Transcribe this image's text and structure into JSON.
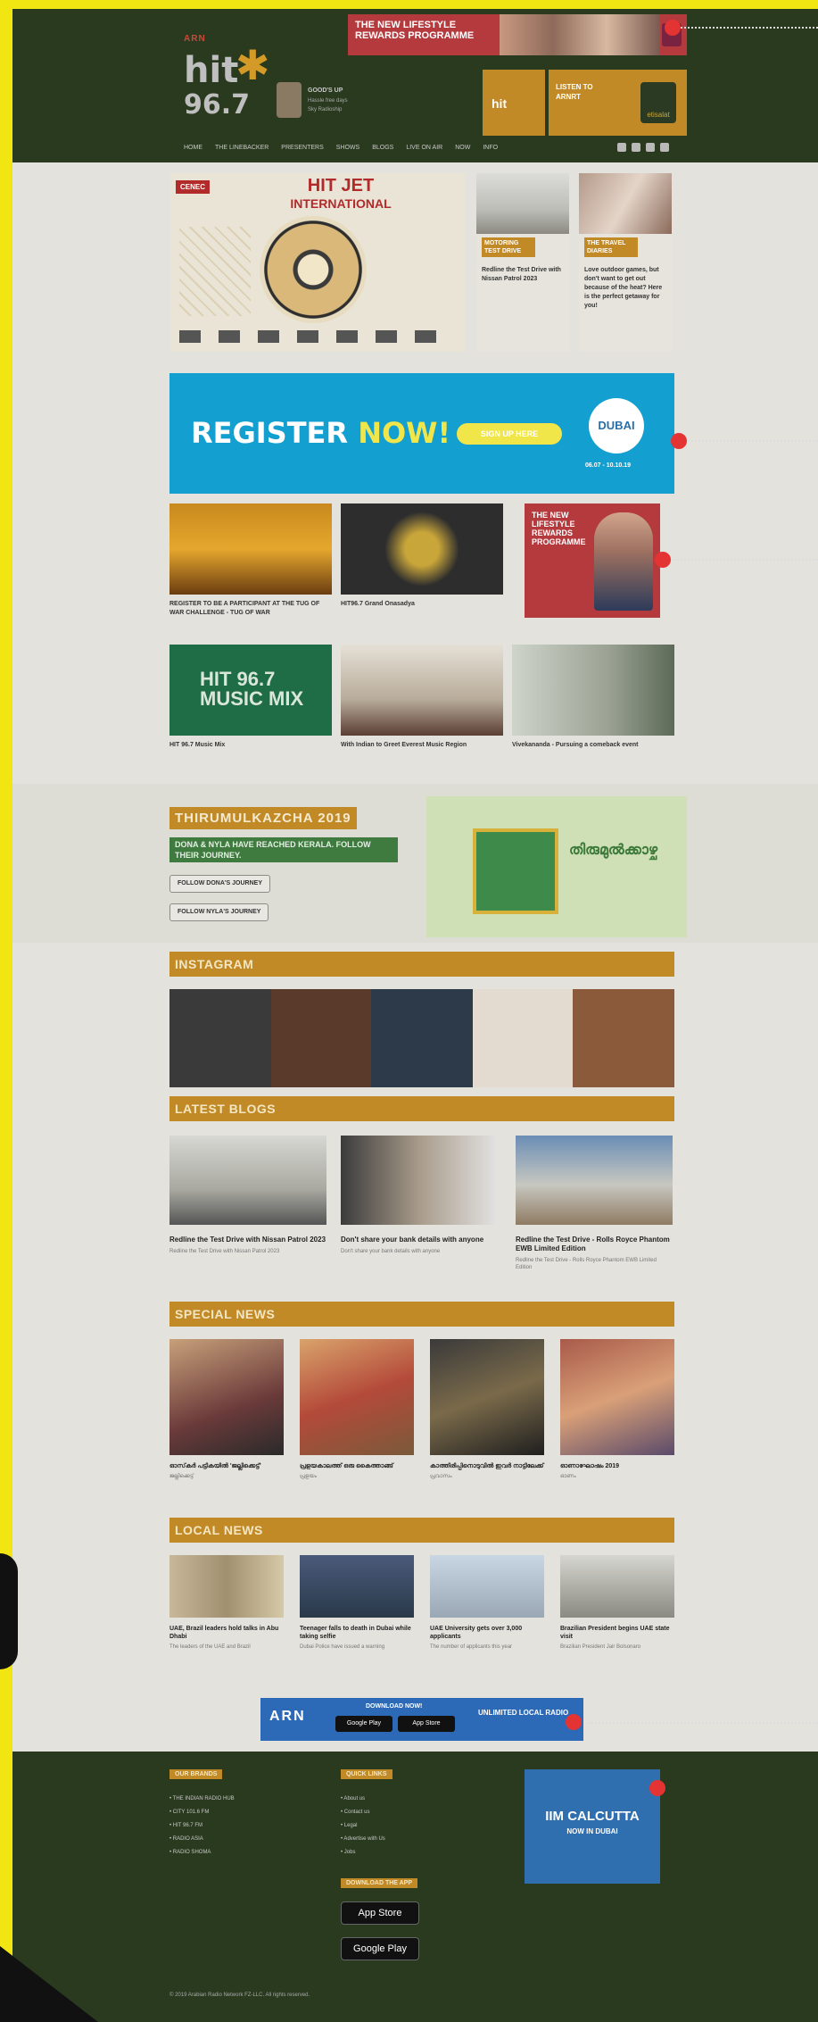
{
  "header": {
    "logo": {
      "brand": "ARN",
      "hit": "hit",
      "number": "96.7"
    },
    "show": {
      "line1": "GOOD'S UP",
      "line2": "Hassle free days",
      "line3": "Sky Radioship"
    },
    "top_banner": {
      "text": "THE NEW LIFESTYLE REWARDS PROGRAMME"
    },
    "promo_tile": {
      "label": "hit"
    },
    "listen_tile": {
      "text": "LISTEN TO ARNRT",
      "brand": "etisalat"
    },
    "nav": [
      "HOME",
      "THE LINEBACKER",
      "PRESENTERS",
      "SHOWS",
      "BLOGS",
      "LIVE ON AIR",
      "NOW",
      "INFO"
    ]
  },
  "hero": {
    "tag": "CENEC",
    "title": "HIT JET",
    "subtitle": "INTERNATIONAL"
  },
  "side_cards": [
    {
      "label": "MOTORING TEST DRIVE",
      "text": "Redline the Test Drive with Nissan Patrol 2023"
    },
    {
      "label": "THE TRAVEL DIARIES",
      "text": "Love outdoor games, but don't want to get out because of the heat? Here is the perfect getaway for you!"
    }
  ],
  "register": {
    "prefix": "REGISTER",
    "highlight": "NOW!",
    "button": "SIGN UP HERE",
    "badge": "DUBAI",
    "dates": "06.07 - 10.10.19"
  },
  "thumbs": [
    {
      "caption": "REGISTER TO BE A PARTICIPANT AT THE TUG OF WAR CHALLENGE - TUG OF WAR"
    },
    {
      "caption": "HIT96.7 Grand Onasadya"
    }
  ],
  "side_ad": {
    "text": "THE NEW LIFESTYLE REWARDS PROGRAMME"
  },
  "thumbs2": [
    {
      "label": "HIT 96.7 MUSIC MIX",
      "caption": "HIT 96.7 Music Mix"
    },
    {
      "caption": "With Indian to Greet Everest Music Region"
    },
    {
      "caption": "Vivekananda - Pursuing a comeback event"
    }
  ],
  "thirumulkazcha": {
    "heading": "THIRUMULKAZCHA 2019",
    "subheading": "DONA & NYLA HAVE REACHED KERALA. FOLLOW THEIR JOURNEY.",
    "btn1": "FOLLOW DONA'S JOURNEY",
    "btn2": "FOLLOW NYLA'S JOURNEY",
    "art_text": "തിരുമുൽക്കാഴ്ച"
  },
  "sections": {
    "instagram": "INSTAGRAM",
    "blogs": "LATEST BLOGS",
    "special": "SPECIAL NEWS",
    "local": "LOCAL NEWS"
  },
  "instagram_tiles": [
    "#3a3a3a",
    "#5a3a2a",
    "#2d3a4a",
    "#e3dad0",
    "#8a5a3a"
  ],
  "blogs": [
    {
      "title": "Redline the Test Drive with Nissan Patrol 2023",
      "meta": "Redline the Test Drive with Nissan Patrol 2023"
    },
    {
      "title": "Don't share your bank details with anyone",
      "meta": "Don't share your bank details with anyone"
    },
    {
      "title": "Redline the Test Drive - Rolls Royce Phantom EWB Limited Edition",
      "meta": "Redline the Test Drive - Rolls Royce Phantom EWB Limited Edition"
    }
  ],
  "special_news": [
    {
      "title": "ഓസ്‌കർ പട്ടികയിൽ 'ജല്ലിക്കെട്ട്'",
      "meta": "ജല്ലിക്കെട്ട്"
    },
    {
      "title": "പ്രളയകാലത്ത് ഒരു കൈത്താങ്ങ്",
      "meta": "പ്രളയം"
    },
    {
      "title": "കാത്തിരിപ്പിനൊടുവിൽ ഇവർ നാട്ടിലേക്ക്",
      "meta": "പ്രവാസം"
    },
    {
      "title": "ഓണാഘോഷം 2019",
      "meta": "ഓണം"
    }
  ],
  "local_news": [
    {
      "title": "UAE, Brazil leaders hold talks in Abu Dhabi",
      "meta": "The leaders of the UAE and Brazil"
    },
    {
      "title": "Teenager falls to death in Dubai while taking selfie",
      "meta": "Dubai Police have issued a warning"
    },
    {
      "title": "UAE University gets over 3,000 applicants",
      "meta": "The number of applicants this year"
    },
    {
      "title": "Brazilian President begins UAE state visit",
      "meta": "Brazilian President Jair Bolsonaro"
    }
  ],
  "app_banner": {
    "logo": "ARN",
    "download": "DOWNLOAD NOW!",
    "store1": "Google Play",
    "store2": "App Store",
    "right": "UNLIMITED LOCAL RADIO"
  },
  "footer": {
    "head1": "OUR BRANDS",
    "list1": [
      "• THE INDIAN RADIO HUB",
      "• CITY 101.6 FM",
      "• HIT 96.7 FM",
      "• RADIO ASIA",
      "• RADIO SHOMA"
    ],
    "head2": "QUICK LINKS",
    "list2": [
      "• About us",
      "• Contact us",
      "• Legal",
      "• Advertise with Us",
      "• Jobs"
    ],
    "head3": "DOWNLOAD THE APP",
    "store1": "App Store",
    "store2": "Google Play",
    "iim1": "IIM CALCUTTA",
    "iim2": "NOW IN DUBAI",
    "copyright": "© 2019 Arabian Radio Network FZ-LLC. All rights reserved."
  }
}
